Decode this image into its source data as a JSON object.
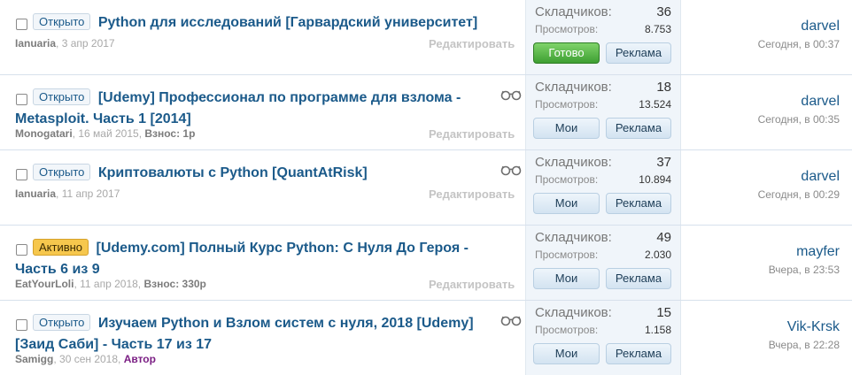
{
  "threads": [
    {
      "prefix": "Открыто",
      "prefix_style": "open",
      "title": "Python для исследований [Гарвардский университет]",
      "author": "Ianuaria",
      "date": "3 апр 2017",
      "extra": "",
      "edit_label": "Редактировать",
      "watched": false,
      "participants_label": "Складчиков:",
      "participants": "36",
      "views_label": "Просмотров:",
      "views": "8.753",
      "button1": "Готово",
      "button1_style": "green",
      "button2": "Реклама",
      "last_user": "darvel",
      "last_time": "Сегодня, в 00:37"
    },
    {
      "prefix": "Открыто",
      "prefix_style": "open",
      "title": "[Udemy] Профессионал по программе для взлома - Metasploit. Часть 1 [2014]",
      "author": "Monogatari",
      "date": "16 май 2015",
      "extra": "Взнос: 1р",
      "edit_label": "Редактировать",
      "watched": true,
      "participants_label": "Складчиков:",
      "participants": "18",
      "views_label": "Просмотров:",
      "views": "13.524",
      "button1": "Мои",
      "button1_style": "normal",
      "button2": "Реклама",
      "last_user": "darvel",
      "last_time": "Сегодня, в 00:35"
    },
    {
      "prefix": "Открыто",
      "prefix_style": "open",
      "title": "Криптовалюты с Python [QuantAtRisk]",
      "author": "Ianuaria",
      "date": "11 апр 2017",
      "extra": "",
      "edit_label": "Редактировать",
      "watched": true,
      "participants_label": "Складчиков:",
      "participants": "37",
      "views_label": "Просмотров:",
      "views": "10.894",
      "button1": "Мои",
      "button1_style": "normal",
      "button2": "Реклама",
      "last_user": "darvel",
      "last_time": "Сегодня, в 00:29"
    },
    {
      "prefix": "Активно",
      "prefix_style": "active",
      "title": "[Udemy.com] Полный Курс Python: С Нуля До Героя - Часть 6 из 9",
      "author": "EatYourLoli",
      "date": "11 апр 2018",
      "extra": "Взнос: 330р",
      "edit_label": "Редактировать",
      "watched": false,
      "participants_label": "Складчиков:",
      "participants": "49",
      "views_label": "Просмотров:",
      "views": "2.030",
      "button1": "Мои",
      "button1_style": "normal",
      "button2": "Реклама",
      "last_user": "mayfer",
      "last_time": "Вчера, в 23:53"
    },
    {
      "prefix": "Открыто",
      "prefix_style": "open",
      "title": "Изучаем Python и Взлом систем с нуля, 2018 [Udemy] [Заид Саби] - Часть 17 из 17",
      "author": "Samigg",
      "date": "30 сен 2018",
      "extra": "",
      "role": "Автор",
      "edit_label": "Редактировать",
      "watched": true,
      "participants_label": "Складчиков:",
      "participants": "15",
      "views_label": "Просмотров:",
      "views": "1.158",
      "button1": "Мои",
      "button1_style": "normal",
      "button2": "Реклама",
      "last_user": "Vik-Krsk",
      "last_time": "Вчера, в 22:28"
    }
  ]
}
